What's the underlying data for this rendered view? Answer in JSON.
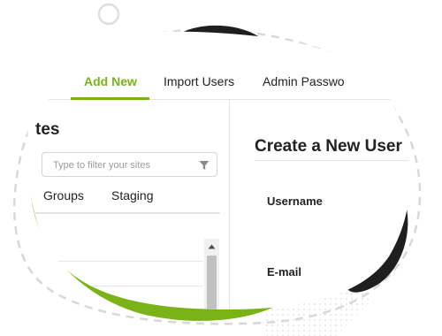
{
  "tabs": [
    {
      "label": "Add New",
      "active": true
    },
    {
      "label": "Import Users",
      "active": false
    },
    {
      "label": "Admin Passwo",
      "active": false
    }
  ],
  "sites_panel": {
    "title_fragment": "tes",
    "filter_placeholder": "Type to filter your sites",
    "subtabs": [
      "Groups",
      "Staging"
    ]
  },
  "form": {
    "title": "Create a New User",
    "fields": [
      {
        "label": "Username"
      },
      {
        "label": "E-mail"
      }
    ]
  },
  "colors": {
    "accent": "#7ab317",
    "dark_blob": "#1f1f1f",
    "text": "#222222"
  },
  "icons": [
    "filter-funnel-icon",
    "scroll-up-arrow-icon"
  ]
}
